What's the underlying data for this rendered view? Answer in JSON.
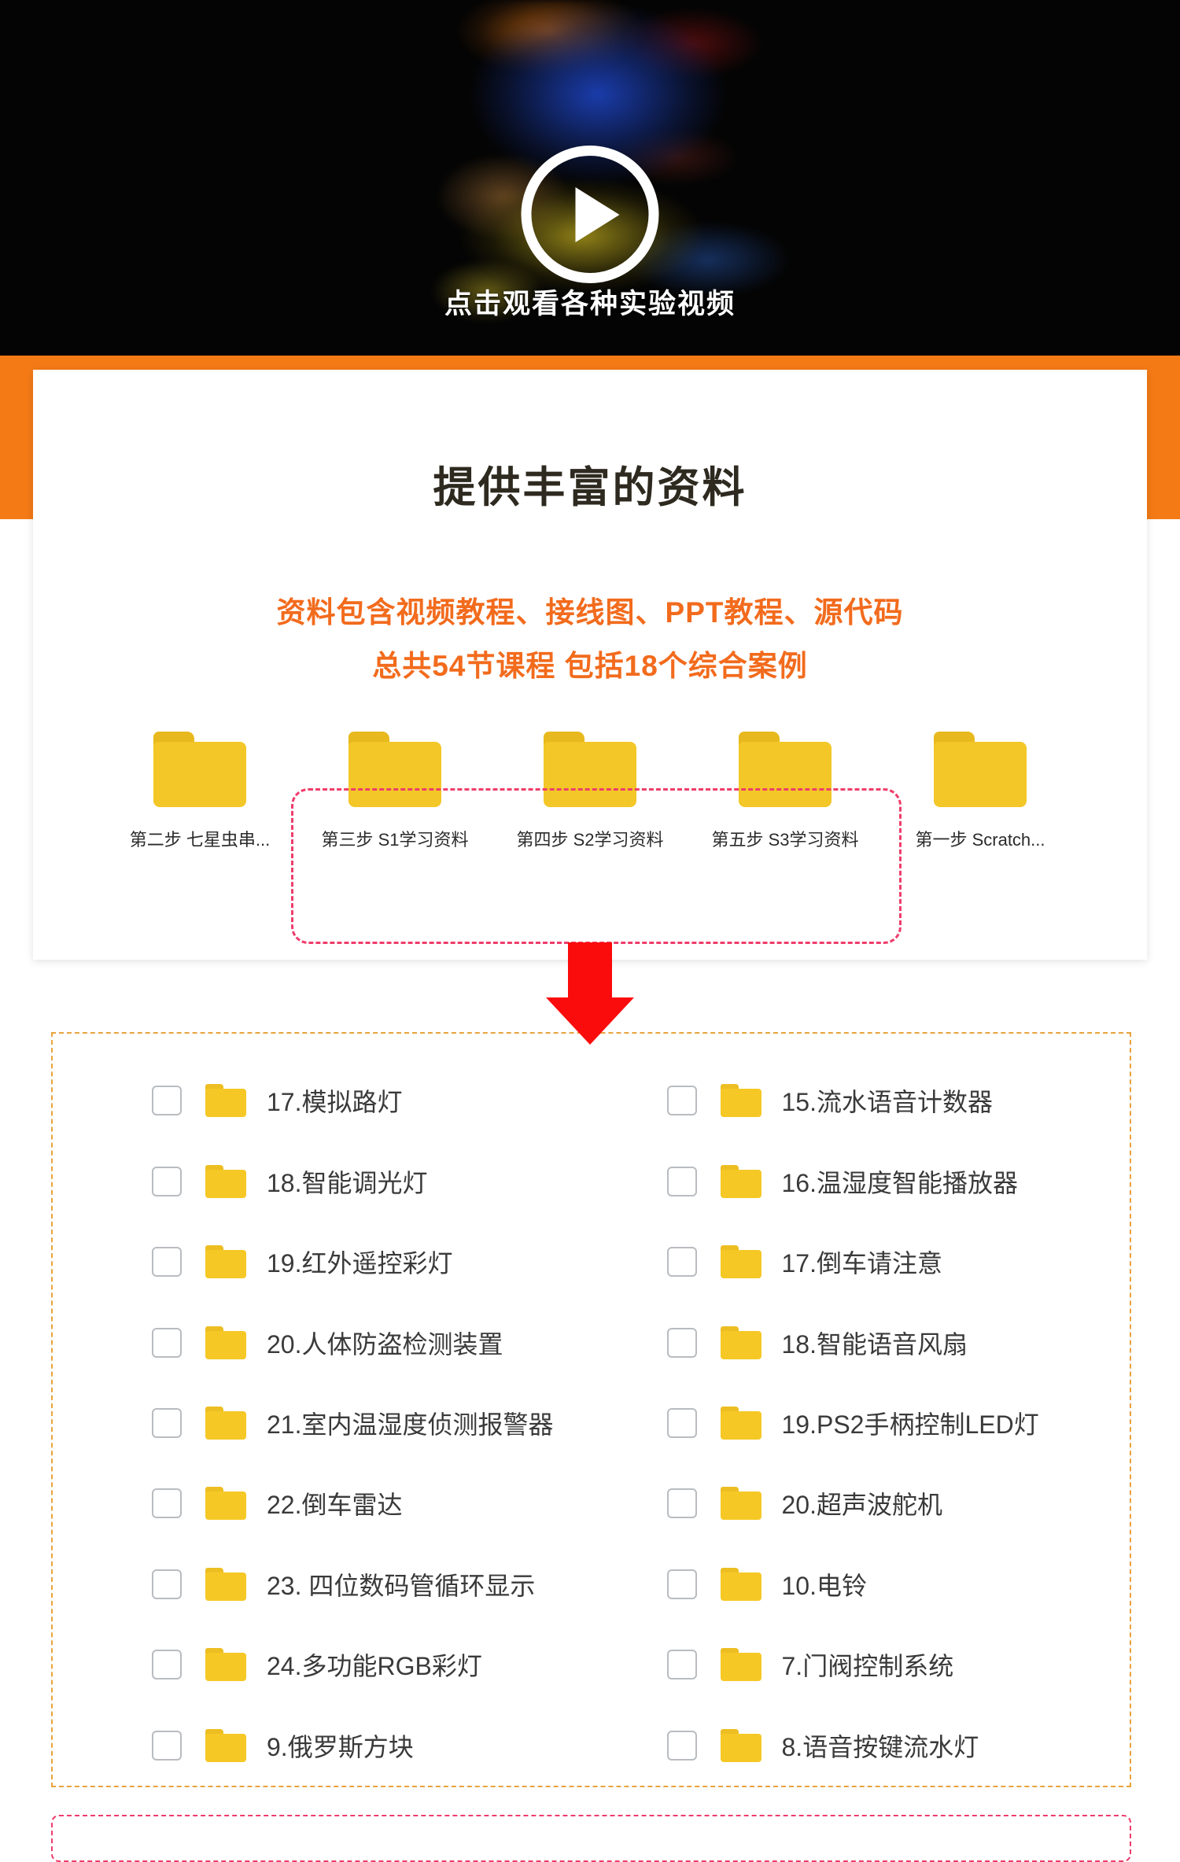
{
  "video": {
    "caption": "点击观看各种实验视频",
    "play_icon": "play-circle-icon"
  },
  "card": {
    "title": "提供丰富的资料",
    "subtitle_line1": "资料包含视频教程、接线图、PPT教程、源代码",
    "subtitle_line2": "总共54节课程 包括18个综合案例",
    "total_lessons": "54",
    "total_cases": "18"
  },
  "colors": {
    "orange_band": "#F47A16",
    "orange_text": "#F26B1D",
    "folder_yellow": "#F3C727",
    "arrow_red": "#FA0C0C",
    "highlight_dash_pink": "#EE3D6B",
    "list_dash_orange": "#E8A33D"
  },
  "folders": [
    {
      "label": "第二步 七星虫串...",
      "highlighted": false
    },
    {
      "label": "第三步 S1学习资料",
      "highlighted": true
    },
    {
      "label": "第四步 S2学习资料",
      "highlighted": true
    },
    {
      "label": "第五步 S3学习资料",
      "highlighted": true
    },
    {
      "label": "第一步 Scratch...",
      "highlighted": false
    }
  ],
  "project_list": {
    "left_column": [
      {
        "label": "17.模拟路灯",
        "checked": false
      },
      {
        "label": "18.智能调光灯",
        "checked": false
      },
      {
        "label": "19.红外遥控彩灯",
        "checked": false
      },
      {
        "label": "20.人体防盗检测装置",
        "checked": false
      },
      {
        "label": "21.室内温湿度侦测报警器",
        "checked": false
      },
      {
        "label": "22.倒车雷达",
        "checked": false
      },
      {
        "label": "23. 四位数码管循环显示",
        "checked": false
      },
      {
        "label": "24.多功能RGB彩灯",
        "checked": false
      },
      {
        "label": "9.俄罗斯方块",
        "checked": false
      }
    ],
    "right_column": [
      {
        "label": "15.流水语音计数器",
        "checked": false
      },
      {
        "label": "16.温湿度智能播放器",
        "checked": false
      },
      {
        "label": "17.倒车请注意",
        "checked": false
      },
      {
        "label": "18.智能语音风扇",
        "checked": false
      },
      {
        "label": "19.PS2手柄控制LED灯",
        "checked": false
      },
      {
        "label": "20.超声波舵机",
        "checked": false
      },
      {
        "label": "10.电铃",
        "checked": false
      },
      {
        "label": "7.门阀控制系统",
        "checked": false
      },
      {
        "label": "8.语音按键流水灯",
        "checked": false
      }
    ]
  }
}
